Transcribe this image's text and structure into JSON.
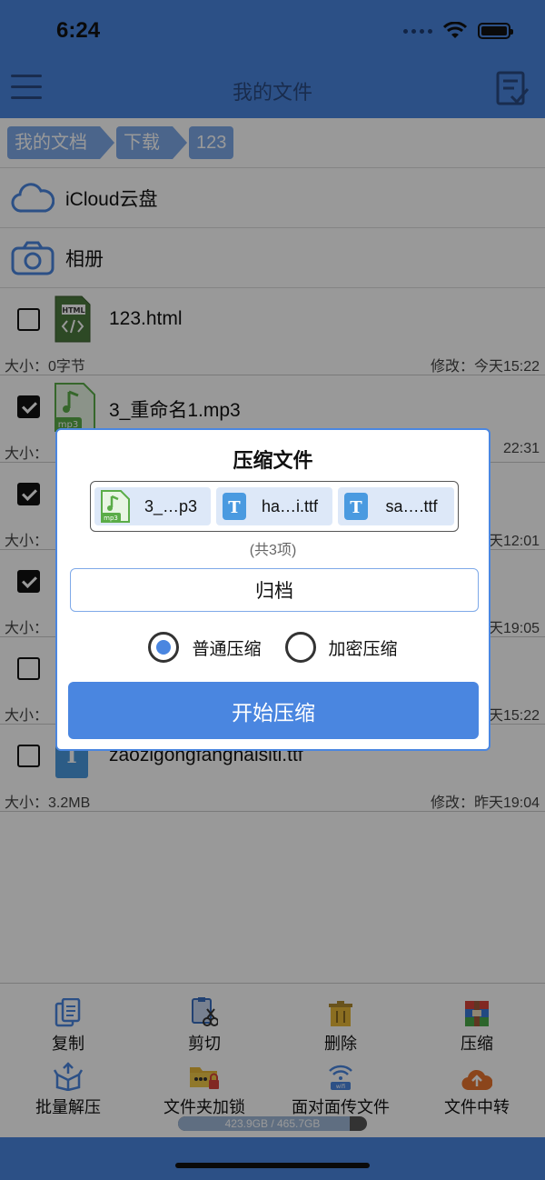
{
  "status": {
    "time": "6:24"
  },
  "nav": {
    "title": "我的文件"
  },
  "breadcrumb": [
    "我的文档",
    "下载",
    "123"
  ],
  "places": [
    {
      "label": "iCloud云盘",
      "icon": "cloud-icon"
    },
    {
      "label": "相册",
      "icon": "camera-icon"
    }
  ],
  "files": [
    {
      "name": "123.html",
      "size": "大小：0字节",
      "modified": "修改：今天15:22",
      "checked": false,
      "type": "html"
    },
    {
      "name": "3_重命名1.mp3",
      "size": "大小：",
      "modified": "22:31",
      "checked": true,
      "type": "mp3"
    },
    {
      "name": "",
      "size": "大小：",
      "modified": "天12:01",
      "checked": true,
      "type": "ttf"
    },
    {
      "name": "",
      "size": "大小：",
      "modified": "天19:05",
      "checked": true,
      "type": "ttf"
    },
    {
      "name": "",
      "size": "大小：",
      "modified": "天15:22",
      "checked": false,
      "type": "ttf"
    },
    {
      "name": "zaozigongfanghaisiti.ttf",
      "size": "大小：3.2MB",
      "modified": "修改：昨天19:04",
      "checked": false,
      "type": "ttf"
    }
  ],
  "toolbar": {
    "row1": [
      "复制",
      "剪切",
      "删除",
      "压缩"
    ],
    "row2": [
      "批量解压",
      "文件夹加锁",
      "面对面传文件",
      "文件中转"
    ],
    "storage_text": "423.9GB / 465.7GB",
    "storage_used_fraction": 0.91
  },
  "modal": {
    "title": "压缩文件",
    "chips": [
      {
        "name": "3_…p3",
        "icon": "mp3-file-icon"
      },
      {
        "name": "ha…i.ttf",
        "icon": "font-file-icon"
      },
      {
        "name": "sa….ttf",
        "icon": "font-file-icon"
      }
    ],
    "count": "(共3项)",
    "archive_name": "归档",
    "option_normal": "普通压缩",
    "option_encrypted": "加密压缩",
    "start_label": "开始压缩"
  },
  "colors": {
    "accent": "#4a86e0",
    "crumb": "#7ea9e8"
  }
}
